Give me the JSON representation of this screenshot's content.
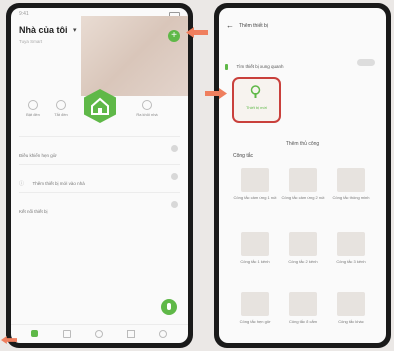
{
  "left_screen": {
    "status_time": "9:41",
    "home_title": "Nhà của tôi",
    "subtitle": "Tuya Smart",
    "quick_actions": [
      {
        "label": "Bật đèn"
      },
      {
        "label": "Tắt đèn"
      },
      {
        "label": "Ra khỏi nhà"
      }
    ],
    "rows": [
      {
        "label": "Điều khiển hẹn giờ"
      },
      {
        "label": "Thêm thiết bị mới vào nhà"
      },
      {
        "label": "Kết nối thiết bị"
      }
    ],
    "bottom_nav": [
      {
        "icon": "home-icon"
      },
      {
        "icon": "scene-icon"
      },
      {
        "icon": "smart-icon"
      },
      {
        "icon": "shop-icon"
      },
      {
        "icon": "profile-icon"
      }
    ]
  },
  "right_screen": {
    "header_title": "Thêm thiết bị",
    "discover_text": "Tìm thiết bị xung quanh",
    "highlight_label": "Thiết bị mới",
    "section_title": "Thêm thủ công",
    "category": "Công tắc",
    "devices": [
      {
        "label": "Công tắc cảm ứng 1 nút"
      },
      {
        "label": "Công tắc cảm ứng 2 nút"
      },
      {
        "label": "Công tắc thông minh"
      },
      {
        "label": "Công tắc 1 kênh"
      },
      {
        "label": "Công tắc 2 kênh"
      },
      {
        "label": "Công tắc 3 kênh"
      },
      {
        "label": "Công tắc hẹn giờ"
      },
      {
        "label": "Công tắc ổ cắm"
      },
      {
        "label": "Công tắc khác"
      }
    ]
  },
  "colors": {
    "accent_green": "#5fb848",
    "highlight_red": "#c9403c",
    "arrow_orange": "#ef7f5e"
  }
}
